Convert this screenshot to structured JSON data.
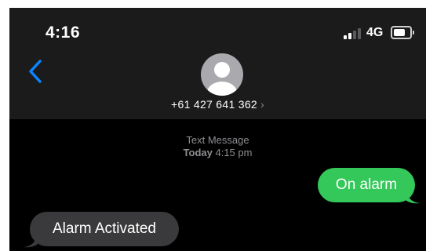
{
  "status_bar": {
    "time": "4:16",
    "network": "4G",
    "signal_bars_active": 2,
    "signal_bars_total": 4,
    "battery_level": 0.7
  },
  "header": {
    "back_icon": "chevron-left-icon",
    "avatar_icon": "person-icon",
    "contact_number": "+61 427 641 362",
    "contact_chevron": "›"
  },
  "conversation": {
    "service": "Text Message",
    "day": "Today",
    "time": "4:15 pm",
    "messages": [
      {
        "direction": "outgoing",
        "text": "On alarm"
      },
      {
        "direction": "incoming",
        "text": "Alarm Activated"
      }
    ]
  },
  "colors": {
    "accent": "#0a84ff",
    "outgoing_bubble": "#34c759",
    "incoming_bubble": "#3a3a3c",
    "header_background": "#1b1b1b",
    "background": "#000000"
  }
}
